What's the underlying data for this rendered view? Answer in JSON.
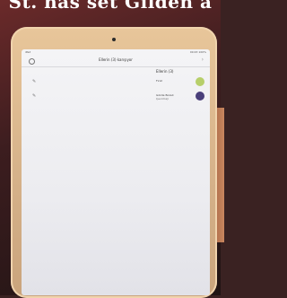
{
  "background_text": "St. has set Gilden a",
  "device": {
    "status_left": "iPad",
    "status_right": "09:43  100%"
  },
  "app": {
    "title": "Ellerin (3) karışıyor",
    "sidebar_icons": [
      "note-icon",
      "note-icon"
    ],
    "section_header": "Ellerin (3)",
    "contacts": [
      {
        "name": "Fırat",
        "subtitle": "",
        "avatar_color": "#b7cf6a"
      },
      {
        "name": "Gözde Bozali",
        "subtitle": "Çevrimiçi",
        "avatar_color": "#4a3f7a"
      }
    ]
  },
  "colors": {
    "tablet_frame": "#d9b68e",
    "screen_bg": "#efeff2",
    "backdrop": "#4a2222"
  }
}
